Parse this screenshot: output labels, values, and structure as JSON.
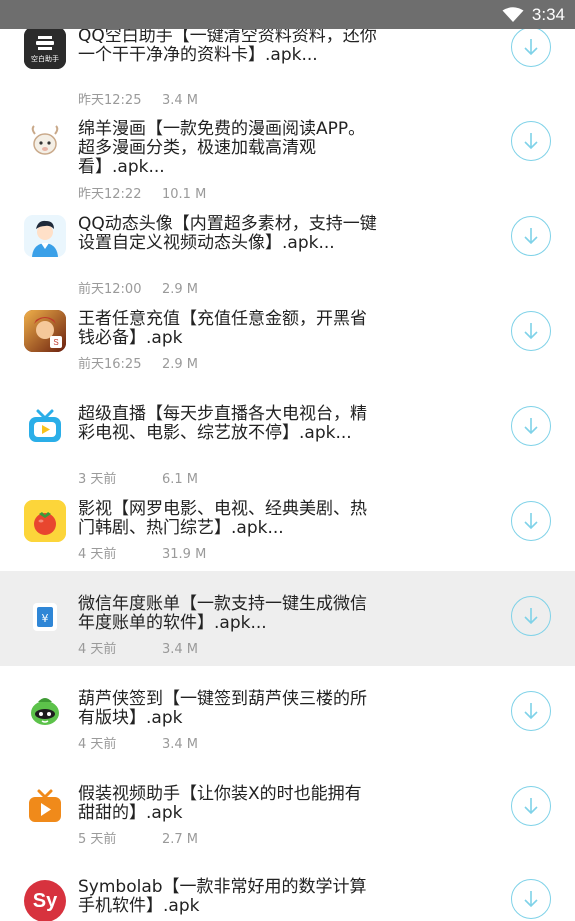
{
  "status_bar": {
    "time": "3:34"
  },
  "apps": [
    {
      "title": "QQ空白助手【一键清空资料资料，还你一个干干净净的资料卡】.apk...",
      "date": "昨天12:25",
      "size": "3.4 M",
      "icon": "qq-blank-helper-icon",
      "icon_text": "空白助手"
    },
    {
      "title": "绵羊漫画【一款免费的漫画阅读APP。超多漫画分类，极速加载高清观看】.apk...",
      "date": "昨天12:22",
      "size": "10.1 M",
      "icon": "sheep-comic-icon"
    },
    {
      "title": "QQ动态头像【内置超多素材，支持一键设置自定义视频动态头像】.apk...",
      "date": "前天12:00",
      "size": "2.9 M",
      "icon": "avatar-person-icon"
    },
    {
      "title": "王者任意充值【充值任意金额，开黑省钱必备】.apk",
      "date": "前天16:25",
      "size": "2.9 M",
      "icon": "game-hero-icon"
    },
    {
      "title": "超级直播【每天步直播各大电视台，精彩电视、电影、综艺放不停】.apk...",
      "date": "3 天前",
      "size": "6.1 M",
      "icon": "tv-icon"
    },
    {
      "title": "影视【网罗电影、电视、经典美剧、热门韩剧、热门综艺】.apk...",
      "date": "4 天前",
      "size": "31.9 M",
      "icon": "tomato-icon"
    },
    {
      "title": "微信年度账单【一款支持一键生成微信年度账单的软件】.apk...",
      "date": "4 天前",
      "size": "3.4 M",
      "icon": "bill-icon",
      "highlighted": true
    },
    {
      "title": "葫芦侠签到【一键签到葫芦侠三楼的所有版块】.apk",
      "date": "4 天前",
      "size": "3.4 M",
      "icon": "gourd-man-icon"
    },
    {
      "title": "假装视频助手【让你装X的时也能拥有甜甜的】.apk",
      "date": "5 天前",
      "size": "2.7 M",
      "icon": "video-play-icon"
    },
    {
      "title": "Symbolab【一款非常好用的数学计算手机软件】.apk",
      "date": "",
      "size": "",
      "icon": "symbolab-icon",
      "icon_text": "Sy"
    }
  ],
  "colors": {
    "status_bar": "#6e6e6e",
    "download_accent": "#7fd2e8",
    "highlight_row": "#eeeeee",
    "meta_text": "#9a9a9a"
  }
}
